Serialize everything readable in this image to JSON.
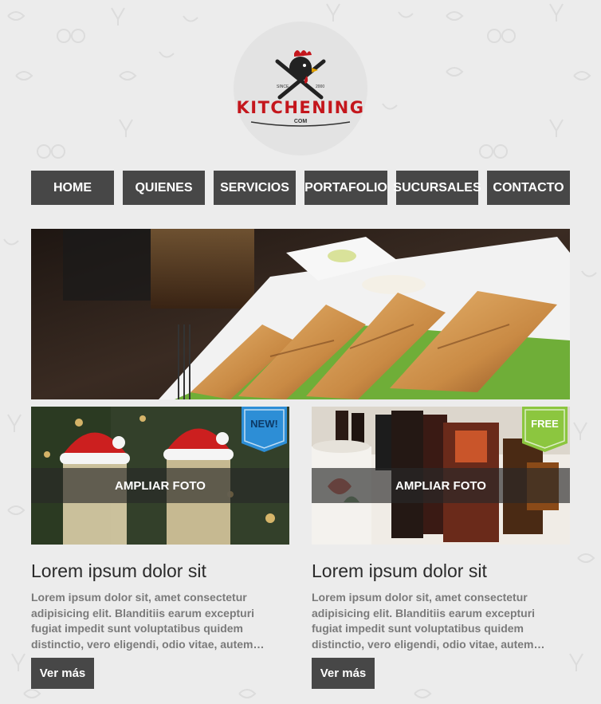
{
  "logo": {
    "wordmark": "KITCHENING",
    "sub": "COM",
    "since": "SINCE",
    "year": "2000"
  },
  "nav": {
    "items": [
      "HOME",
      "QUIENES",
      "SERVICIOS",
      "PORTAFOLIO",
      "SUCURSALES",
      "CONTACTO"
    ]
  },
  "cards": [
    {
      "badge": "NEW!",
      "badge_color": "#2d8ed6",
      "overlay": "AMPLIAR FOTO",
      "title": "Lorem ipsum dolor sit",
      "text": "Lorem ipsum dolor sit, amet consectetur adipisicing elit. Blanditiis earum excepturi fugiat impedit sunt voluptatibus quidem distinctio, vero eligendi, odio vitae, autem…",
      "button": "Ver más"
    },
    {
      "badge": "FREE",
      "badge_color": "#8cc63f",
      "overlay": "AMPLIAR FOTO",
      "title": "Lorem ipsum dolor sit",
      "text": "Lorem ipsum dolor sit, amet consectetur adipisicing elit. Blanditiis earum excepturi fugiat impedit sunt voluptatibus quidem distinctio, vero eligendi, odio vitae, autem…",
      "button": "Ver más"
    }
  ]
}
